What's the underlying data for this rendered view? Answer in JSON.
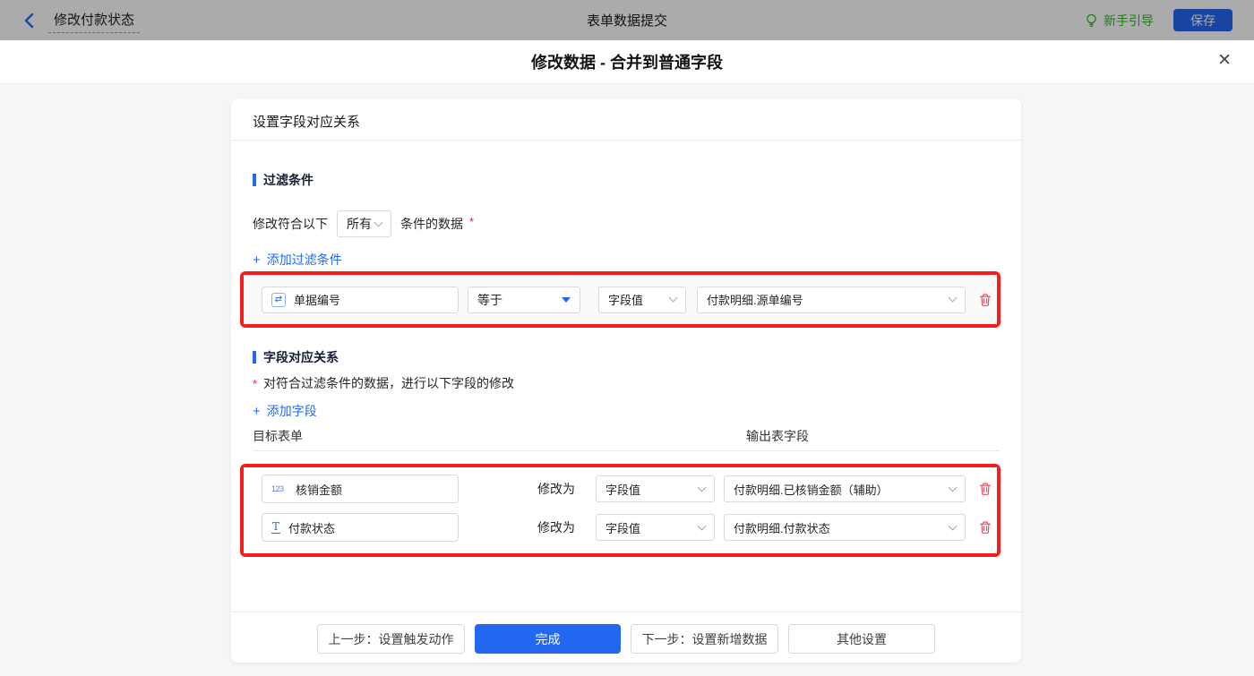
{
  "topbar": {
    "back_title": "修改付款状态",
    "center_title": "表单数据提交",
    "guide_label": "新手引导",
    "save_label": "保存"
  },
  "dialog": {
    "title": "修改数据 - 合并到普通字段",
    "close_glyph": "✕"
  },
  "icons": {
    "serial_glyph": "⇄",
    "number_glyph": "123",
    "text_glyph": "T",
    "plus_glyph": "+"
  },
  "card": {
    "header": "设置字段对应关系",
    "filter": {
      "title": "过滤条件",
      "match_prefix": "修改符合以下",
      "match_value": "所有",
      "match_suffix": "条件的数据",
      "required_mark": "*",
      "add_label": "添加过滤条件",
      "row": {
        "field": "单据编号",
        "operator": "等于",
        "value_type": "字段值",
        "value": "付款明细.源单编号"
      }
    },
    "mapping": {
      "title": "字段对应关系",
      "required_mark": "*",
      "description": "对符合过滤条件的数据，进行以下字段的修改",
      "add_label": "添加字段",
      "columns": {
        "target": "目标表单",
        "output": "输出表字段"
      },
      "modify_label": "修改为",
      "rows": [
        {
          "field": "核销金额",
          "value_type": "字段值",
          "value": "付款明细.已核销金额（辅助）"
        },
        {
          "field": "付款状态",
          "value_type": "字段值",
          "value": "付款明细.付款状态"
        }
      ]
    },
    "footer": {
      "prev": "上一步：设置触发动作",
      "done": "完成",
      "next": "下一步：设置新增数据",
      "other": "其他设置"
    }
  },
  "colors": {
    "accent_blue": "#2468f2",
    "guide_green": "#30bb1d",
    "annotation_red": "#f51d1d",
    "delete_pink": "#ee4d63"
  }
}
